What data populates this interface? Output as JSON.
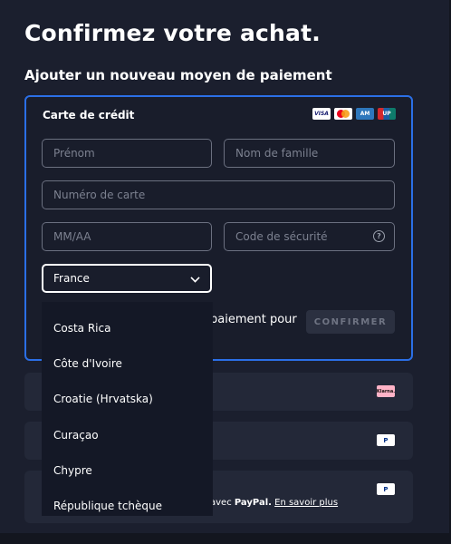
{
  "page": {
    "title": "Confirmez votre achat.",
    "section_title": "Ajouter un nouveau moyen de paiement"
  },
  "card": {
    "title": "Carte de crédit",
    "logos": [
      "visa-icon",
      "mastercard-icon",
      "amex-icon",
      "unionpay-icon"
    ],
    "logo_text": {
      "visa": "VISA",
      "amex": "AM",
      "unionpay": "UP"
    },
    "first_name_placeholder": "Prénom",
    "last_name_placeholder": "Nom de famille",
    "card_number_placeholder": "Numéro de carte",
    "expiry_placeholder": "MM/AA",
    "cvc_placeholder": "Code de sécurité",
    "help_glyph": "?",
    "country_value": "France",
    "save_text": "paiement pour",
    "confirm_label": "CONFIRMER",
    "accent": "#2b6fe6"
  },
  "country_dropdown": {
    "options": [
      "Costa Rica",
      "Côte d'Ivoire",
      "Croatie (Hrvatska)",
      "Curaçao",
      "Chypre",
      "République tchèque"
    ]
  },
  "payment_methods": {
    "klarna_badge": "Klarna.",
    "paypal_badge": "P",
    "paypal_text_prefix": "avec ",
    "paypal_text_brand": "PayPal.",
    "paypal_link": "En savoir plus"
  }
}
